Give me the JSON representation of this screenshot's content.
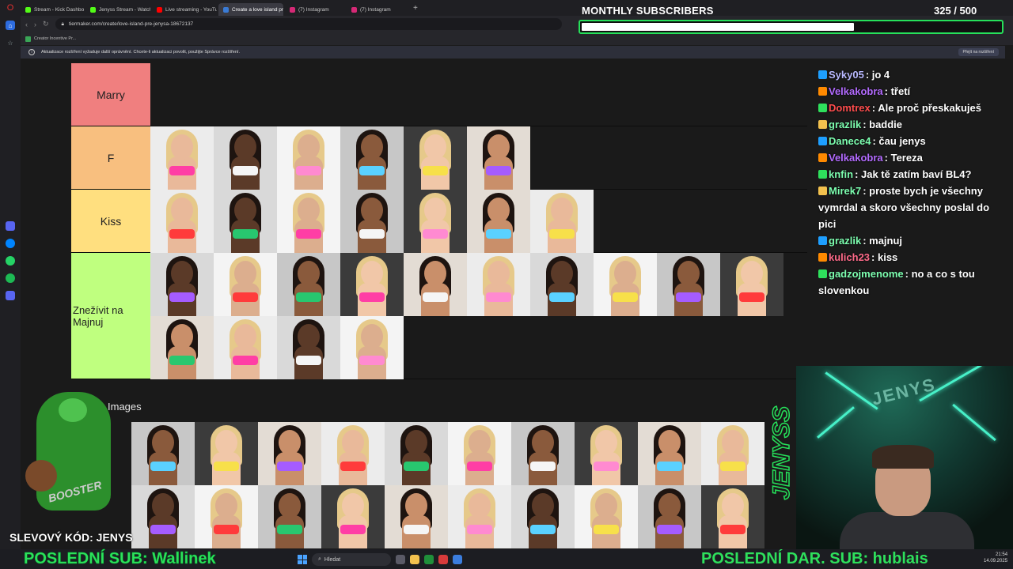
{
  "browser": {
    "tabs": [
      {
        "label": "Stream - Kick Dashboard",
        "color": "#53fc18"
      },
      {
        "label": "Jenyss Stream - Watch Li",
        "color": "#53fc18"
      },
      {
        "label": "Live streaming - YouTube",
        "color": "#ff0000"
      },
      {
        "label": "Create a love island pre",
        "color": "#3a7bd5",
        "active": true
      },
      {
        "label": "(7) Instagram",
        "color": "#d62976"
      },
      {
        "label": "(7) Instagram",
        "color": "#d62976"
      }
    ],
    "url": "tiermaker.com/create/love-island-pre-jenysa-18672137",
    "bookmark": "Creator Incentive Pr...",
    "notice": "Aktualizace rozšíření vyžaduje další oprávnění. Chcete-li aktualizaci povolit, použijte Správce rozšíření.",
    "notice_button": "Přejít na rozšíření"
  },
  "tiers": [
    {
      "label": "Marry",
      "color": "#f07f7f",
      "items": 0
    },
    {
      "label": "F",
      "color": "#f8bf7f",
      "items": 6
    },
    {
      "label": "Kiss",
      "color": "#ffdf7f",
      "items": 7
    },
    {
      "label": "Znežívit na Majnuj",
      "color": "#bfff7f",
      "items": 14
    }
  ],
  "images_heading": "Images",
  "pool_count": 20,
  "overlay": {
    "title": "MONTHLY SUBSCRIBERS",
    "count": "325 / 500",
    "progress_fraction": 0.65,
    "accent": "#26e05a"
  },
  "chat": [
    {
      "user": "Syky05",
      "text": ": jo 4",
      "color": "#b9b9ff"
    },
    {
      "user": "Velkakobra",
      "text": ": třetí",
      "color": "#b36bff"
    },
    {
      "user": "Domtrex",
      "text": ": Ale proč přeskakuješ",
      "color": "#ff4d4d"
    },
    {
      "user": "grazlik",
      "text": ": baddie",
      "color": "#7dffb0"
    },
    {
      "user": "Danece4",
      "text": ": čau jenys",
      "color": "#7dffb0"
    },
    {
      "user": "Velkakobra",
      "text": ": Tereza",
      "color": "#b36bff"
    },
    {
      "user": "knfin",
      "text": ": Jak tě zatím baví BL4?",
      "color": "#7dffb0"
    },
    {
      "user": "Mirek7",
      "text": ": proste bych je všechny vymrdal a skoro všechny poslal do pici",
      "color": "#7dffb0"
    },
    {
      "user": "grazlik",
      "text": ": majnuj",
      "color": "#7dffb0"
    },
    {
      "user": "kulich23",
      "text": ": kiss",
      "color": "#ff6b8a"
    },
    {
      "user": "gadzojmenome",
      "text": ": no a co s tou slovenkou",
      "color": "#7dffb0"
    }
  ],
  "brand": "JENYSS",
  "mascot_text": "BOOSTER",
  "promo": "SLEVOVÝ KÓD: JENYS",
  "ticker": {
    "last_sub": "POSLEDNÍ SUB: Wallinek",
    "last_gift": "POSLEDNÍ DAR. SUB: hublais"
  },
  "taskbar": {
    "search": "Hledat",
    "time": "21:54",
    "date": "14.09.2025"
  }
}
